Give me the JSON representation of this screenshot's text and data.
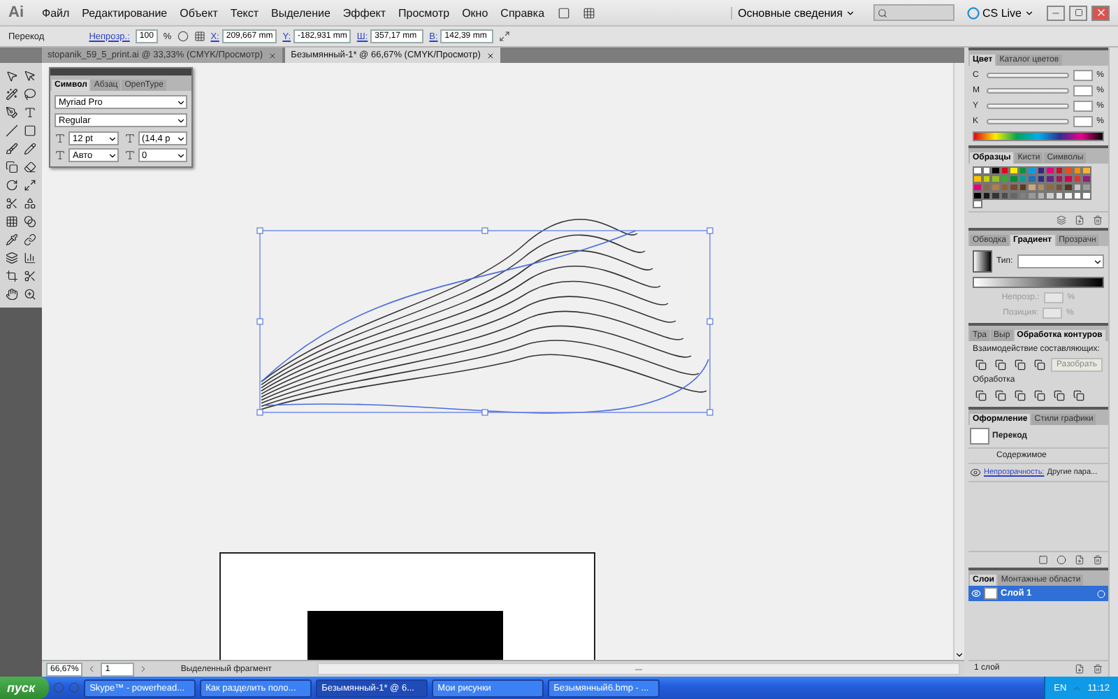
{
  "app": {
    "logo": "Ai"
  },
  "menu": [
    "Файл",
    "Редактирование",
    "Объект",
    "Текст",
    "Выделение",
    "Эффект",
    "Просмотр",
    "Окно",
    "Справка"
  ],
  "workspace": {
    "label": "Основные сведения"
  },
  "cs_live": "CS Live",
  "control_bar": {
    "label": "Перекод",
    "opacity_label": "Непрозр.:",
    "opacity": "100",
    "opacity_unit": "%",
    "fields": [
      {
        "label": "X:",
        "value": "209,667 mm"
      },
      {
        "label": "Y:",
        "value": "-182,931 mm"
      },
      {
        "label": "Ш:",
        "value": "357,17 mm"
      },
      {
        "label": "В:",
        "value": "142,39 mm"
      }
    ]
  },
  "documents": [
    {
      "title": "stopanik_59_5_print.ai @ 33,33% (CMYK/Просмотр)",
      "selected": false
    },
    {
      "title": "Безымянный-1* @ 66,67% (CMYK/Просмотр)",
      "selected": true
    }
  ],
  "character_panel": {
    "tabs": [
      {
        "label": "Символ",
        "selected": true
      },
      {
        "label": "Абзац",
        "selected": false
      },
      {
        "label": "OpenType",
        "selected": false
      }
    ],
    "font_family": "Myriad Pro",
    "font_style": "Regular",
    "size": "12 pt",
    "leading": "(14,4 p",
    "kerning": "Авто",
    "tracking": "0"
  },
  "color_panel": {
    "tabs": [
      {
        "label": "Цвет",
        "selected": true
      },
      {
        "label": "Каталог цветов",
        "selected": false
      }
    ],
    "channels": [
      "C",
      "M",
      "Y",
      "K"
    ],
    "unit": "%"
  },
  "swatches_panel": {
    "tabs": [
      {
        "label": "Образцы",
        "selected": true
      },
      {
        "label": "Кисти",
        "selected": false
      },
      {
        "label": "Символы",
        "selected": false
      }
    ],
    "swatches": [
      {
        "color": "#ffffff"
      },
      {
        "color": "#ffffff"
      },
      {
        "color": "#000000"
      },
      {
        "color": "#e30613"
      },
      {
        "color": "#ffed00"
      },
      {
        "color": "#009640"
      },
      {
        "color": "#009fe3"
      },
      {
        "color": "#312783"
      },
      {
        "color": "#e5007d"
      },
      {
        "color": "#c8102e"
      },
      {
        "color": "#e94e1b"
      },
      {
        "color": "#f39200"
      },
      {
        "color": "#f9b233"
      },
      {
        "color": "#fdc300"
      },
      {
        "color": "#c5d200"
      },
      {
        "color": "#95c11f"
      },
      {
        "color": "#3aaa35"
      },
      {
        "color": "#008d36"
      },
      {
        "color": "#00a19a"
      },
      {
        "color": "#1d71b8"
      },
      {
        "color": "#2d2e83"
      },
      {
        "color": "#662483"
      },
      {
        "color": "#a3195b"
      },
      {
        "color": "#d6004f"
      },
      {
        "color": "#e6332a"
      },
      {
        "color": "#951b81"
      },
      {
        "color": "#e50079"
      },
      {
        "color": "#8c6a47"
      },
      {
        "color": "#b17f4a"
      },
      {
        "color": "#936037"
      },
      {
        "color": "#7b4a2c"
      },
      {
        "color": "#5d3a1a"
      },
      {
        "color": "#cfa876"
      },
      {
        "color": "#b58b5a"
      },
      {
        "color": "#8f6a3b"
      },
      {
        "color": "#7a5230"
      },
      {
        "color": "#53361e"
      },
      {
        "color": "#c6c6c6"
      },
      {
        "color": "#9d9d9c"
      },
      {
        "color": "#000000"
      },
      {
        "color": "#1a1a1a"
      },
      {
        "color": "#333333"
      },
      {
        "color": "#4d4d4d"
      },
      {
        "color": "#666666"
      },
      {
        "color": "#808080"
      },
      {
        "color": "#999999"
      },
      {
        "color": "#b3b3b3"
      },
      {
        "color": "#cccccc"
      },
      {
        "color": "#e6e6e6"
      },
      {
        "color": "#f2f2f2"
      },
      {
        "color": "#ffffff"
      },
      {
        "color": "#ffffff"
      },
      {
        "color": "#ffffff"
      }
    ]
  },
  "gradient_panel": {
    "tabs": [
      {
        "label": "Обводка",
        "selected": false
      },
      {
        "label": "Градиент",
        "selected": true
      },
      {
        "label": "Прозрачн",
        "selected": false
      }
    ],
    "type_label": "Тип:",
    "opacity_label": "Непрозр.:",
    "position_label": "Позиция:",
    "unit": "%"
  },
  "pathfinder_panel": {
    "tabs": [
      {
        "label": "Тра",
        "selected": false
      },
      {
        "label": "Выр",
        "selected": false
      },
      {
        "label": "Обработка контуров",
        "selected": true
      }
    ],
    "shape_modes_label": "Взаимодействие составляющих:",
    "expand_button": "Разобрать",
    "pathfinders_label": "Обработка"
  },
  "appearance_panel": {
    "tabs": [
      {
        "label": "Оформление",
        "selected": true
      },
      {
        "label": "Стили графики",
        "selected": false
      }
    ],
    "title": "Перекод",
    "contents": "Содержимое",
    "opacity_link": "Непрозрачность:",
    "opacity_value": "Другие пара..."
  },
  "layers_panel": {
    "tabs": [
      {
        "label": "Слои",
        "selected": true
      },
      {
        "label": "Монтажные области",
        "selected": false
      }
    ],
    "layers": [
      {
        "name": "Слой 1",
        "selected": true
      }
    ],
    "count": "1 слой"
  },
  "status_bar": {
    "zoom": "66,67%",
    "page": "1",
    "status": "Выделенный фрагмент"
  },
  "taskbar": {
    "start": "пуск",
    "tasks": [
      {
        "title": "Skype™ - powerhead...",
        "selected": false
      },
      {
        "title": "Как разделить поло...",
        "selected": false
      },
      {
        "title": "Безымянный-1* @ 6...",
        "selected": true
      },
      {
        "title": "Мои рисунки",
        "selected": false
      },
      {
        "title": "Безымянный6.bmp - ...",
        "selected": false
      }
    ],
    "language": "EN",
    "time": "11:12"
  }
}
